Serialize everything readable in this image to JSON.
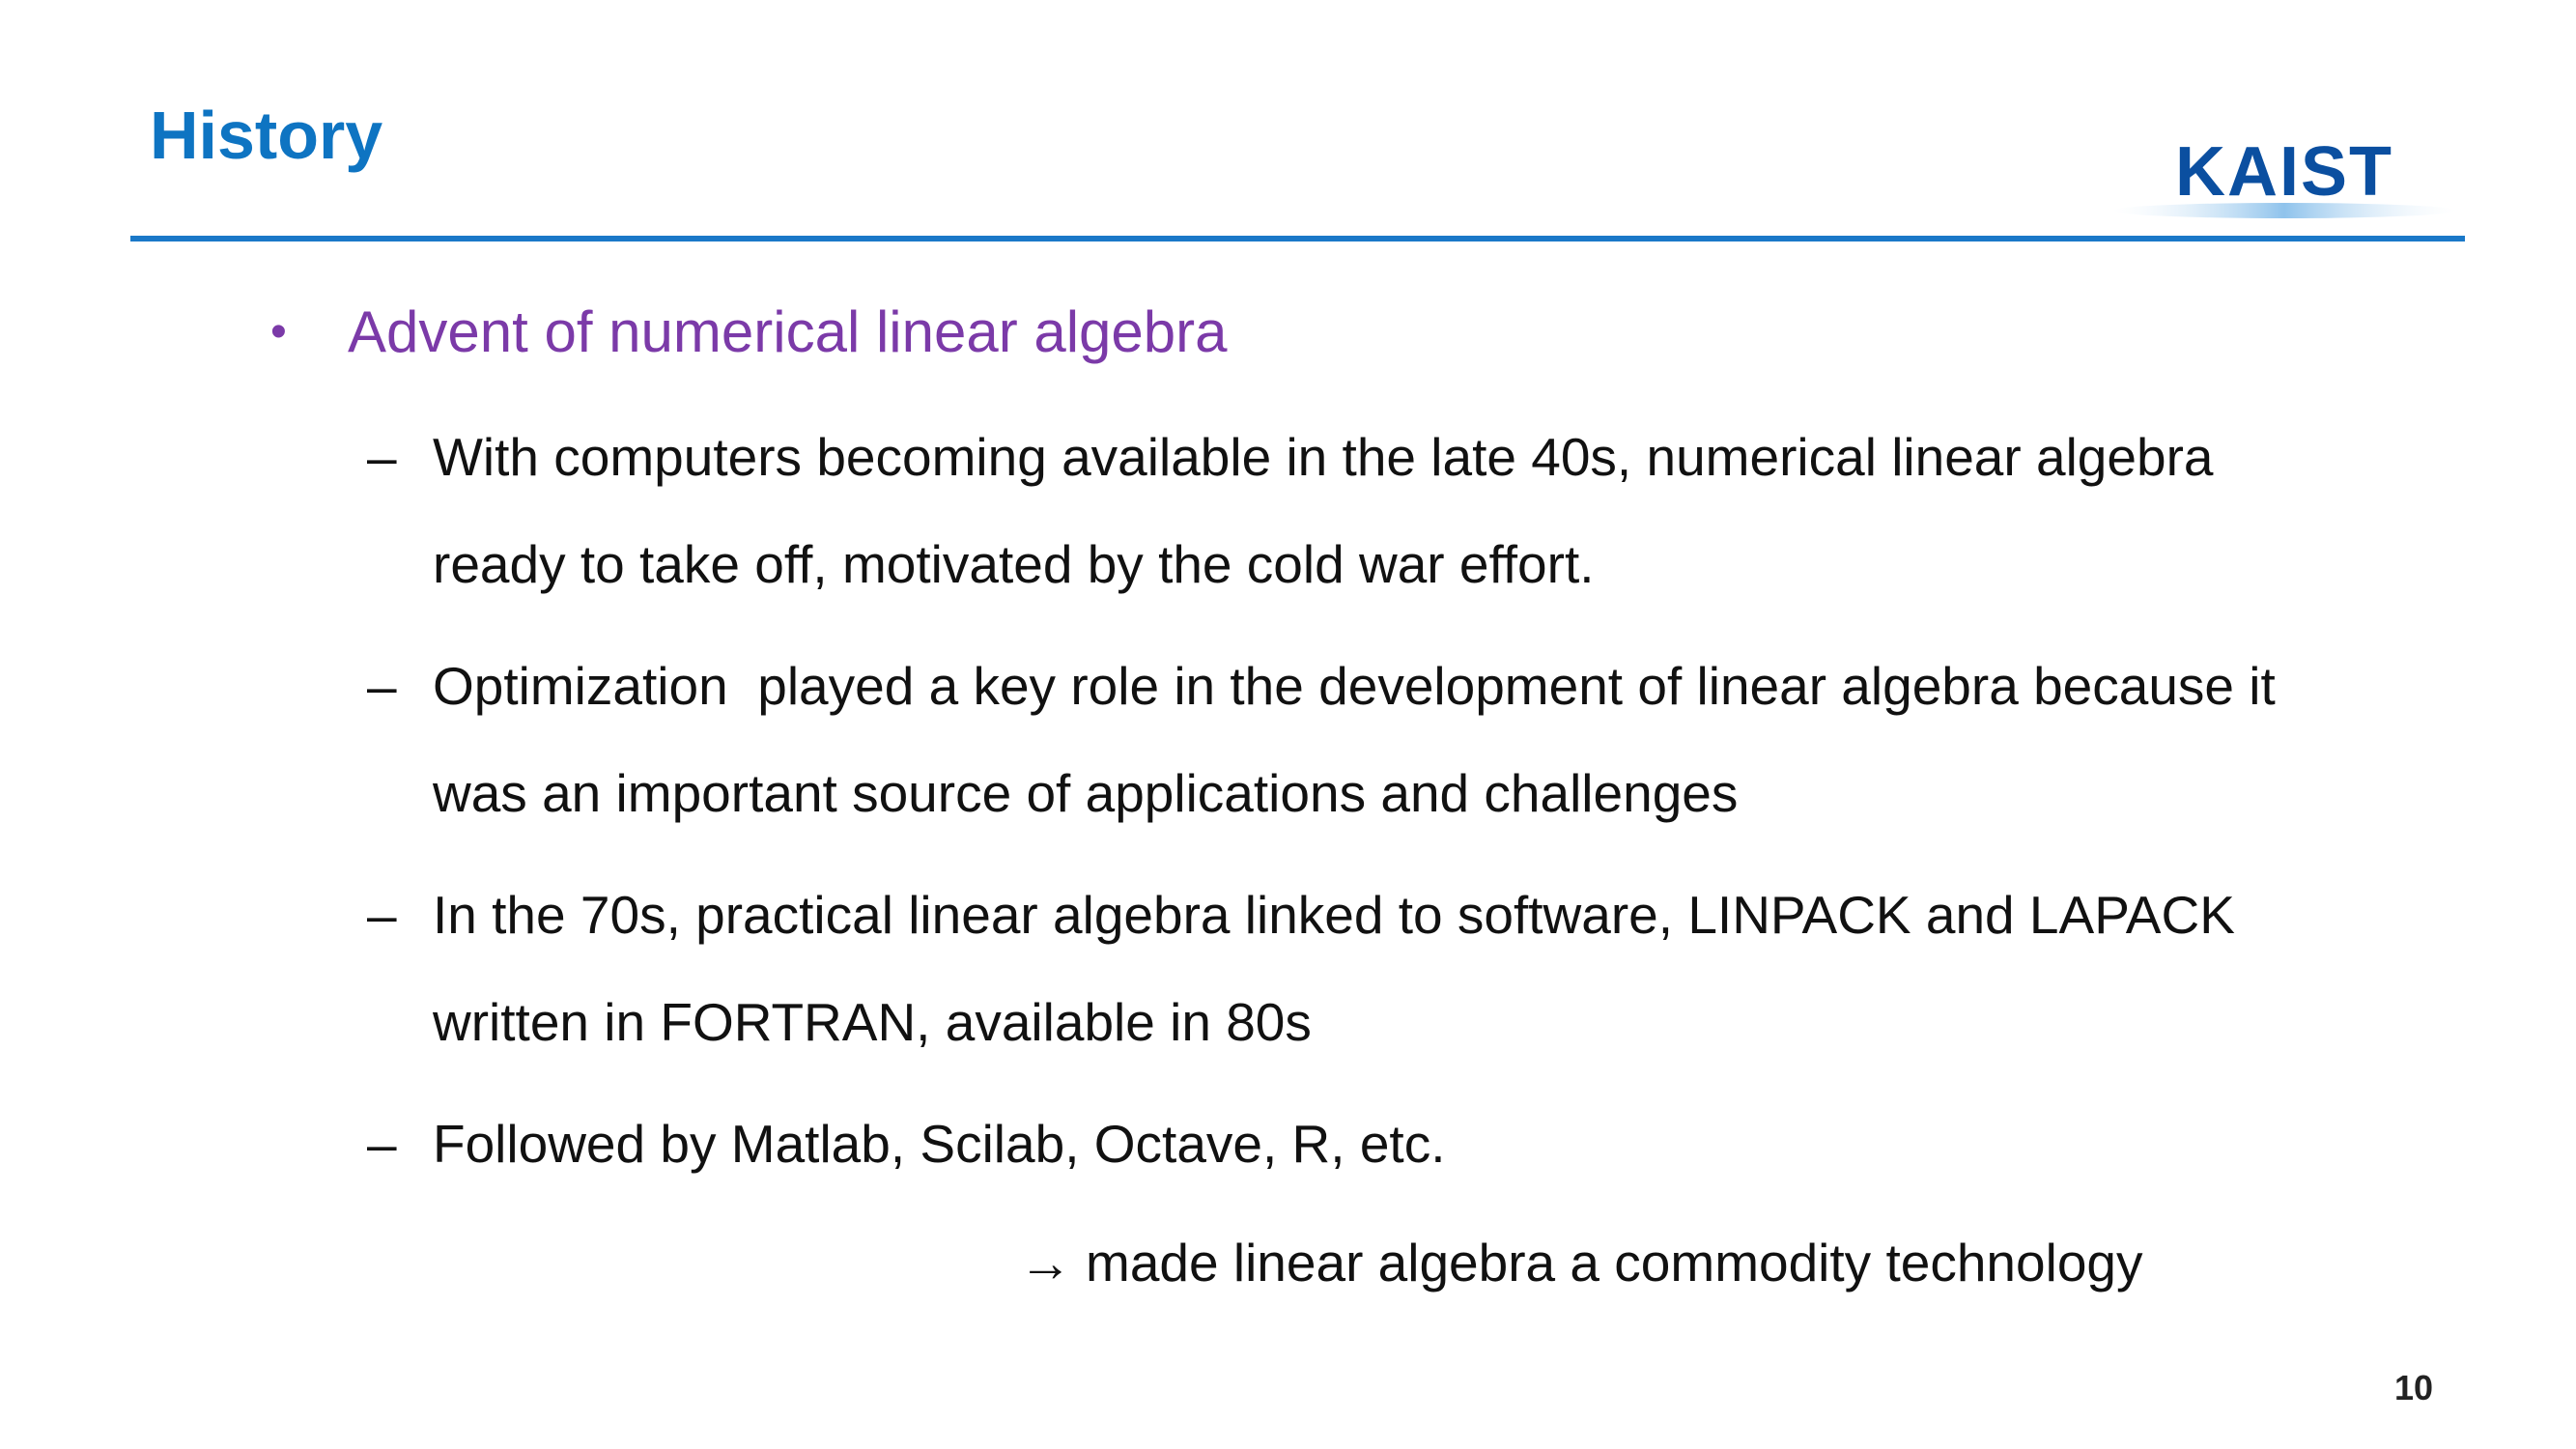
{
  "slide": {
    "title": "History",
    "logo_text": "KAIST",
    "page_number": "10",
    "colors": {
      "title": "#0e74c2",
      "rule": "#1a78c8",
      "bullet_heading": "#7b3aa8",
      "body_text": "#111111",
      "logo_text": "#0b4fa0",
      "logo_swoosh": "#8fc3ec"
    }
  },
  "content": {
    "bullet_symbol": "•",
    "heading": "Advent of numerical linear algebra",
    "dash_symbol": "–",
    "items": [
      "With computers becoming available in the late 40s, numerical linear algebra ready to take off, motivated by the cold war effort.",
      "Optimization  played a key role in the development of linear algebra because it  was an important source of applications and challenges",
      "In the 70s, practical linear algebra linked to software, LINPACK and LAPACK written in FORTRAN, available in 80s",
      "Followed by Matlab, Scilab, Octave, R, etc."
    ],
    "arrow_symbol": "→",
    "conclusion": "made linear algebra a commodity technology"
  }
}
